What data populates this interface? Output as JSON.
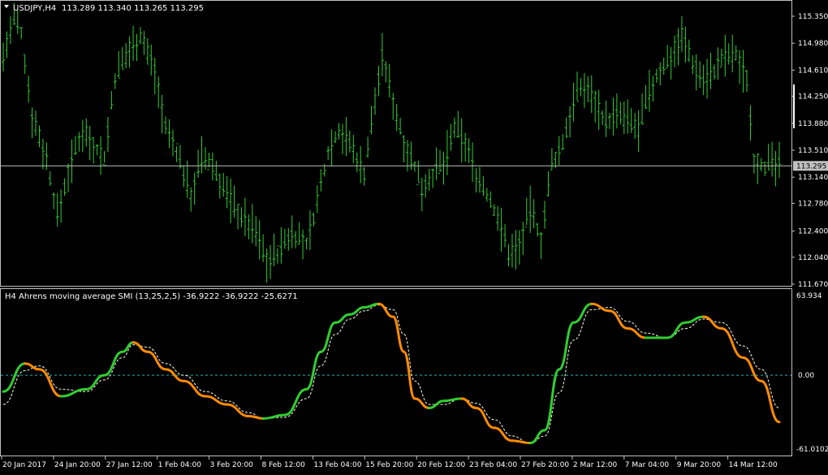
{
  "main_header": {
    "symbol_label": "USDJPY,H4",
    "ohlc": "113.289 113.340 113.265 113.295"
  },
  "indicator_header": "H4 Ahrens moving average SMI (13,25,2,5) -36.9222 -36.9222 -25.6271",
  "colors": {
    "background": "#000000",
    "candles": "#32CD32",
    "frame": "#C0C0C0",
    "axis_text": "#FFFFFF",
    "price_line": "#C0C0C0",
    "smi_up": "#32CD32",
    "smi_down": "#FF8C00",
    "signal": "#FFFFE0",
    "zero_line": "#20B2AA"
  },
  "price_axis": {
    "ticks": [
      "115.350",
      "114.980",
      "114.610",
      "114.250",
      "113.880",
      "113.510",
      "113.140",
      "112.780",
      "112.400",
      "112.040",
      "111.670"
    ],
    "current_price": "113.295"
  },
  "indicator_axis": {
    "max_label": "63.934",
    "zero_label": "0.00",
    "min_label": "-61.0102"
  },
  "time_axis": {
    "labels": [
      "20 Jan 2017",
      "24 Jan 20:00",
      "27 Jan 12:00",
      "1 Feb 04:00",
      "3 Feb 20:00",
      "8 Feb 12:00",
      "13 Feb 04:00",
      "15 Feb 20:00",
      "20 Feb 12:00",
      "23 Feb 04:00",
      "27 Feb 20:00",
      "2 Mar 12:00",
      "7 Mar 04:00",
      "9 Mar 20:00",
      "14 Mar 12:00"
    ]
  },
  "chart_data": {
    "type": "line",
    "price_range": [
      111.67,
      115.4
    ],
    "price_trajectory": [
      [
        0,
        114.8
      ],
      [
        3,
        115.3
      ],
      [
        5,
        115.1
      ],
      [
        8,
        114.0
      ],
      [
        12,
        113.4
      ],
      [
        15,
        112.6
      ],
      [
        18,
        113.2
      ],
      [
        22,
        113.8
      ],
      [
        25,
        113.6
      ],
      [
        28,
        113.4
      ],
      [
        31,
        114.5
      ],
      [
        35,
        114.9
      ],
      [
        38,
        115.1
      ],
      [
        42,
        114.6
      ],
      [
        45,
        113.8
      ],
      [
        48,
        113.5
      ],
      [
        52,
        112.9
      ],
      [
        55,
        113.4
      ],
      [
        58,
        113.3
      ],
      [
        62,
        112.9
      ],
      [
        66,
        112.6
      ],
      [
        70,
        112.4
      ],
      [
        73,
        112.0
      ],
      [
        76,
        112.1
      ],
      [
        80,
        112.4
      ],
      [
        84,
        112.2
      ],
      [
        87,
        112.8
      ],
      [
        90,
        113.5
      ],
      [
        93,
        113.8
      ],
      [
        96,
        113.6
      ],
      [
        100,
        113.2
      ],
      [
        103,
        114.2
      ],
      [
        105,
        114.8
      ],
      [
        107,
        114.4
      ],
      [
        110,
        113.8
      ],
      [
        113,
        113.4
      ],
      [
        116,
        113.0
      ],
      [
        119,
        113.2
      ],
      [
        122,
        113.3
      ],
      [
        125,
        113.8
      ],
      [
        128,
        113.6
      ],
      [
        131,
        113.2
      ],
      [
        134,
        112.9
      ],
      [
        137,
        112.6
      ],
      [
        140,
        112.1
      ],
      [
        143,
        112.2
      ],
      [
        146,
        112.7
      ],
      [
        149,
        112.3
      ],
      [
        152,
        113.3
      ],
      [
        155,
        113.6
      ],
      [
        158,
        114.2
      ],
      [
        161,
        114.4
      ],
      [
        164,
        114.2
      ],
      [
        167,
        113.9
      ],
      [
        170,
        114.0
      ],
      [
        173,
        113.9
      ],
      [
        176,
        113.8
      ],
      [
        179,
        114.3
      ],
      [
        182,
        114.6
      ],
      [
        185,
        114.8
      ],
      [
        188,
        115.1
      ],
      [
        191,
        114.7
      ],
      [
        194,
        114.5
      ],
      [
        197,
        114.6
      ],
      [
        200,
        114.8
      ],
      [
        203,
        114.8
      ],
      [
        206,
        114.5
      ],
      [
        208,
        113.4
      ],
      [
        211,
        113.3
      ],
      [
        214,
        113.3
      ]
    ],
    "smi_series": {
      "name": "Ahrens moving average SMI",
      "points": [
        [
          0,
          -14
        ],
        [
          6,
          10
        ],
        [
          10,
          5
        ],
        [
          16,
          -18
        ],
        [
          23,
          -12
        ],
        [
          28,
          0
        ],
        [
          33,
          20
        ],
        [
          36,
          28
        ],
        [
          40,
          20
        ],
        [
          45,
          5
        ],
        [
          50,
          -5
        ],
        [
          56,
          -18
        ],
        [
          62,
          -25
        ],
        [
          68,
          -35
        ],
        [
          72,
          -37
        ],
        [
          78,
          -34
        ],
        [
          84,
          -12
        ],
        [
          88,
          20
        ],
        [
          92,
          45
        ],
        [
          96,
          52
        ],
        [
          100,
          58
        ],
        [
          104,
          61
        ],
        [
          108,
          50
        ],
        [
          111,
          20
        ],
        [
          114,
          -20
        ],
        [
          118,
          -28
        ],
        [
          122,
          -22
        ],
        [
          127,
          -20
        ],
        [
          131,
          -28
        ],
        [
          136,
          -45
        ],
        [
          141,
          -56
        ],
        [
          146,
          -58
        ],
        [
          150,
          -47
        ],
        [
          154,
          5
        ],
        [
          158,
          45
        ],
        [
          163,
          61
        ],
        [
          168,
          55
        ],
        [
          173,
          40
        ],
        [
          178,
          32
        ],
        [
          184,
          32
        ],
        [
          189,
          45
        ],
        [
          194,
          50
        ],
        [
          199,
          40
        ],
        [
          205,
          15
        ],
        [
          210,
          -5
        ],
        [
          215,
          -40
        ]
      ]
    },
    "signal_series": {
      "name": "signal",
      "points": [
        [
          0,
          -25
        ],
        [
          6,
          4
        ],
        [
          10,
          8
        ],
        [
          16,
          -12
        ],
        [
          23,
          -14
        ],
        [
          28,
          -4
        ],
        [
          33,
          15
        ],
        [
          36,
          26
        ],
        [
          40,
          24
        ],
        [
          45,
          10
        ],
        [
          50,
          0
        ],
        [
          56,
          -14
        ],
        [
          62,
          -22
        ],
        [
          68,
          -32
        ],
        [
          72,
          -37
        ],
        [
          78,
          -36
        ],
        [
          84,
          -20
        ],
        [
          88,
          8
        ],
        [
          92,
          35
        ],
        [
          96,
          48
        ],
        [
          100,
          55
        ],
        [
          104,
          60
        ],
        [
          108,
          56
        ],
        [
          111,
          35
        ],
        [
          114,
          -5
        ],
        [
          118,
          -25
        ],
        [
          122,
          -25
        ],
        [
          127,
          -20
        ],
        [
          131,
          -24
        ],
        [
          136,
          -38
        ],
        [
          141,
          -52
        ],
        [
          146,
          -58
        ],
        [
          150,
          -52
        ],
        [
          154,
          -15
        ],
        [
          158,
          30
        ],
        [
          163,
          56
        ],
        [
          168,
          58
        ],
        [
          173,
          46
        ],
        [
          178,
          36
        ],
        [
          184,
          32
        ],
        [
          189,
          40
        ],
        [
          194,
          48
        ],
        [
          199,
          45
        ],
        [
          205,
          25
        ],
        [
          210,
          5
        ],
        [
          215,
          -28
        ]
      ]
    },
    "smi_range": [
      -61.0102,
      63.934
    ]
  }
}
